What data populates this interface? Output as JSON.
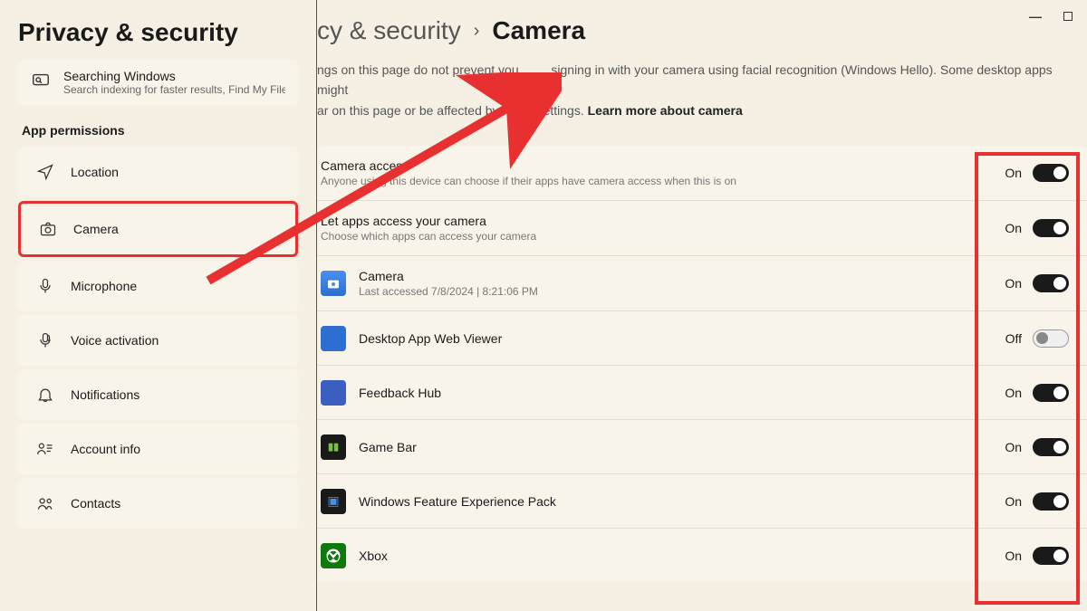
{
  "sidebar": {
    "title": "Privacy & security",
    "searching": {
      "title": "Searching Windows",
      "desc": "Search indexing for faster results, Find My Files, folders"
    },
    "section_label": "App permissions",
    "items": [
      {
        "label": "Location"
      },
      {
        "label": "Camera"
      },
      {
        "label": "Microphone"
      },
      {
        "label": "Voice activation"
      },
      {
        "label": "Notifications"
      },
      {
        "label": "Account info"
      },
      {
        "label": "Contacts"
      }
    ]
  },
  "main": {
    "breadcrumb": {
      "parent": "cy & security",
      "sep": "›",
      "current": "Camera"
    },
    "description_part1": "ngs on this page do not prevent you ",
    "description_part2": " signing in with your camera using facial recognition (Windows Hello). Some desktop apps might",
    "description_part3": "ar on this page or be affected by ",
    "description_part4": "ettings.  ",
    "learn_more": "Learn more about camera",
    "camera_access": {
      "title": "Camera access",
      "subtitle": "Anyone using this device can choose if their apps have camera access when this is on",
      "state": "On"
    },
    "let_apps": {
      "title": "Let apps access your camera",
      "subtitle": "Choose which apps can access your camera",
      "state": "On"
    },
    "apps": [
      {
        "name": "Camera",
        "subtitle": "Last accessed 7/8/2024  |  8:21:06 PM",
        "state": "On",
        "icon": "camera-blue"
      },
      {
        "name": "Desktop App Web Viewer",
        "subtitle": "",
        "state": "Off",
        "icon": "blue-square"
      },
      {
        "name": "Feedback Hub",
        "subtitle": "",
        "state": "On",
        "icon": "feedback"
      },
      {
        "name": "Game Bar",
        "subtitle": "",
        "state": "On",
        "icon": "gamebar"
      },
      {
        "name": "Windows Feature Experience Pack",
        "subtitle": "",
        "state": "On",
        "icon": "wfep"
      },
      {
        "name": "Xbox",
        "subtitle": "",
        "state": "On",
        "icon": "xbox"
      }
    ]
  },
  "annotations": {
    "highlight_sidebar": "Camera",
    "highlight_toggles": true,
    "arrow": true
  }
}
